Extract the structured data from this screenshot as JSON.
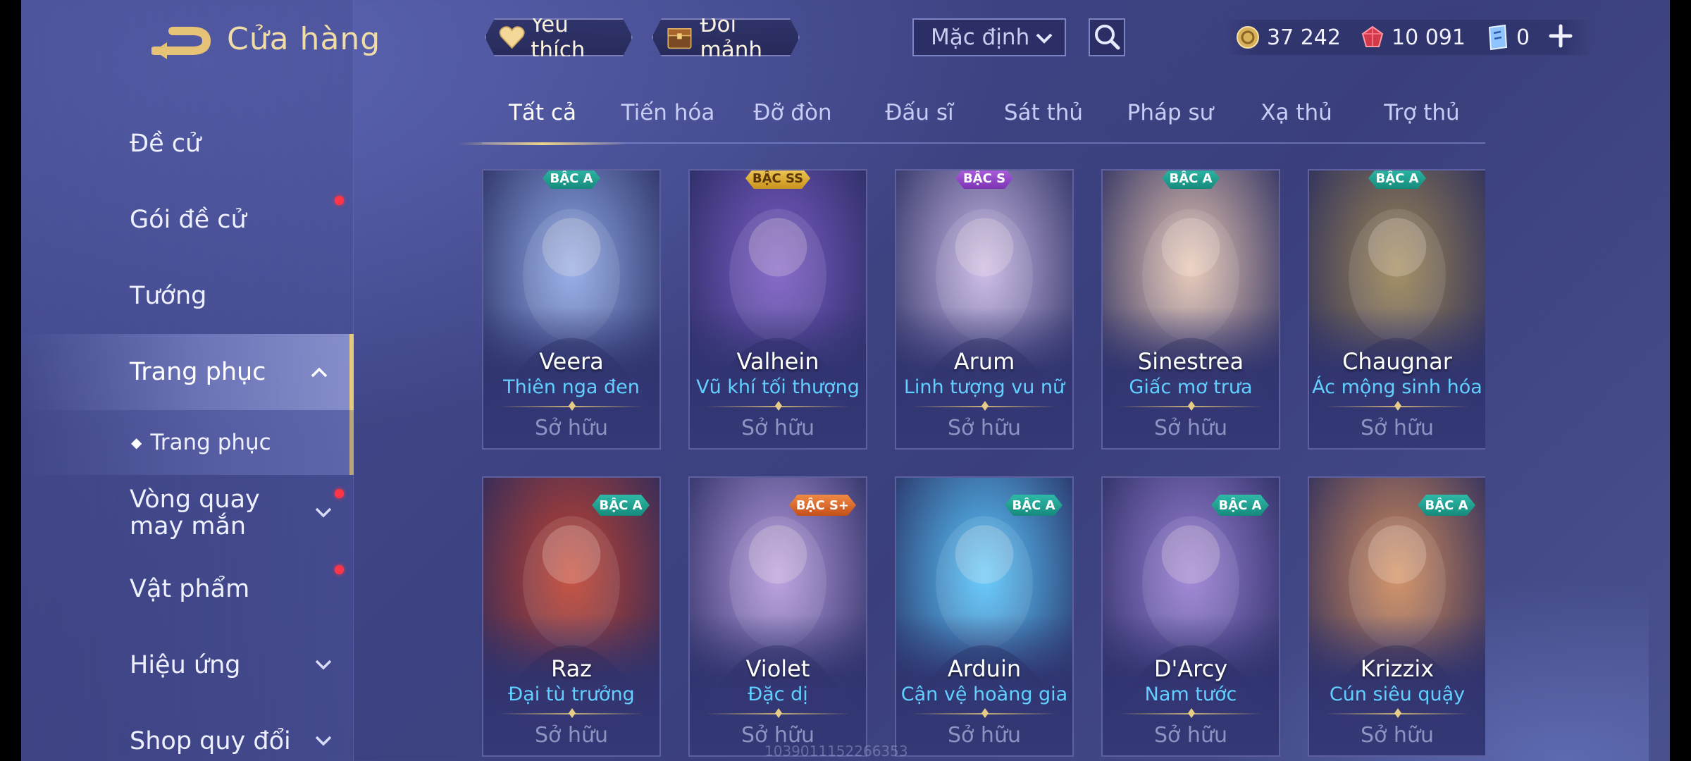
{
  "header": {
    "title": "Cửa hàng"
  },
  "topbar": {
    "favorite_label": "Yêu thích",
    "exchange_label": "Đổi mảnh",
    "sort_value": "Mặc định",
    "currencies": [
      {
        "name": "gold",
        "icon": "gold-coin-icon",
        "value": "37 242"
      },
      {
        "name": "ruby",
        "icon": "ruby-gem-icon",
        "value": "10 091"
      },
      {
        "name": "voucher",
        "icon": "voucher-ticket-icon",
        "value": "0"
      }
    ]
  },
  "sidebar": {
    "items": [
      {
        "label": "Đề cử"
      },
      {
        "label": "Gói đề cử",
        "notify": true
      },
      {
        "label": "Tướng"
      },
      {
        "label": "Trang phục",
        "active": true
      },
      {
        "label": "Trang phục",
        "sub": true
      },
      {
        "label": "Vòng quay may mắn",
        "notify": true
      },
      {
        "label": "Vật phẩm",
        "notify": true
      },
      {
        "label": "Hiệu ứng"
      },
      {
        "label": "Shop quy đổi"
      }
    ]
  },
  "tabs": [
    "Tất cả",
    "Tiến hóa",
    "Đỡ đòn",
    "Đấu sĩ",
    "Sát thủ",
    "Pháp sư",
    "Xạ thủ",
    "Trợ thủ"
  ],
  "active_tab": "Tất cả",
  "skins": [
    {
      "hero": "Veera",
      "skin": "Thiên nga đen",
      "tier": "BẬC A",
      "status": "Sở hữu",
      "accent": "#8fa9e8"
    },
    {
      "hero": "Valhein",
      "skin": "Vũ khí tối thượng",
      "tier": "BẬC SS",
      "status": "Sở hữu",
      "accent": "#7b5bc6"
    },
    {
      "hero": "Arum",
      "skin": "Linh tượng vu nữ",
      "tier": "BẬC S",
      "status": "Sở hữu",
      "accent": "#c9b8e6"
    },
    {
      "hero": "Sinestrea",
      "skin": "Giấc mơ trưa",
      "tier": "BẬC A",
      "status": "Sở hữu",
      "accent": "#e6c5b3"
    },
    {
      "hero": "Chaugnar",
      "skin": "Ác mộng sinh hóa",
      "tier": "BẬC A",
      "status": "Sở hữu",
      "accent": "#9b8454"
    },
    {
      "hero": "Raz",
      "skin": "Đại tù trưởng",
      "tier": "BẬC A",
      "status": "Sở hữu",
      "accent": "#c2422f"
    },
    {
      "hero": "Violet",
      "skin": "Đặc dị",
      "tier": "BẬC S+",
      "status": "Sở hữu",
      "accent": "#b79be0"
    },
    {
      "hero": "Arduin",
      "skin": "Cận vệ hoàng gia",
      "tier": "BẬC A",
      "status": "Sở hữu",
      "accent": "#5ac8ff"
    },
    {
      "hero": "D'Arcy",
      "skin": "Nam tước",
      "tier": "BẬC A",
      "status": "Sở hữu",
      "accent": "#9a7fd6"
    },
    {
      "hero": "Krizzix",
      "skin": "Cún siêu quậy",
      "tier": "BẬC A",
      "status": "Sở hữu",
      "accent": "#d08a5a"
    }
  ],
  "watermark": "1039011152266353"
}
